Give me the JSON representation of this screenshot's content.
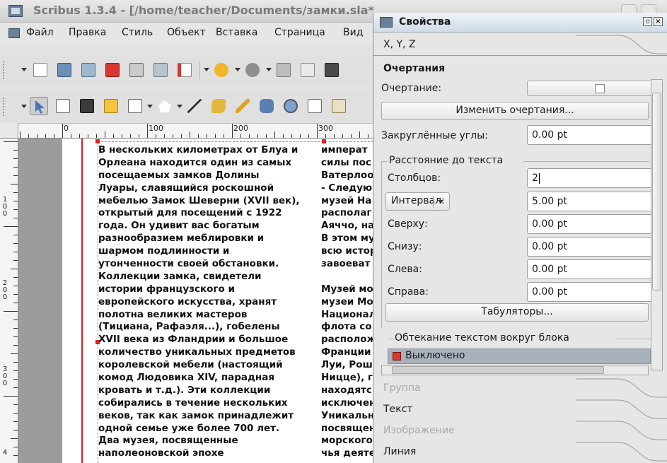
{
  "window": {
    "title": "Scribus 1.3.4 - [/home/teacher/Documents/замки.sla*"
  },
  "menubar": {
    "items": [
      "Файл",
      "Правка",
      "Стиль",
      "Объект",
      "Вставка",
      "Страница",
      "Вид"
    ]
  },
  "ruler": {
    "labels": [
      "0",
      "100",
      "200",
      "300"
    ]
  },
  "vertical_ruler": {
    "labels": [
      "100",
      "200",
      "300",
      "4"
    ]
  },
  "document": {
    "column1": [
      "В нескольких километрах от Блуа и",
      "Орлеана находится один из самых",
      "посещаемых замков Долины",
      "Луары, славящийся роскошной",
      "мебелью Замок Шеверни (XVII век),",
      "открытый для посещений с 1922",
      "года. Он удивит вас богатым",
      "разнообразием меблировки и",
      "шармом подлинности и",
      "утонченности своей обстановки.",
      "Коллекции замка, свидетели",
      "истории французского и",
      "европейского искусства, хранят",
      "полотна великих мастеров",
      "(Тициана, Рафаэля...), гобелены",
      "XVII века из Фландрии и большое",
      "количество уникальных предметов",
      "королевской мебели (настоящий",
      "комод Людовика XIV, парадная",
      "кровать и т.д.). Эти коллекции",
      "собирались в течение нескольких",
      "веков, так как замок принадлежит",
      "одной семье уже более 700 лет.",
      "Два музея, посвященные",
      "наполеоновской эпохе"
    ],
    "column2": [
      "императ",
      "силы пос",
      "Ватерлоо",
      "- Следую",
      "музей На",
      "располаг",
      "Аяччо, на",
      "В этом му",
      "всю истор",
      "завоеват",
      "",
      "Музей мо",
      "музеи Мо",
      "Национал",
      "флота со",
      "располож",
      "Франции",
      "Луи, Рош",
      "Ниццe), г",
      "находятс",
      "исключен",
      "Уникальн",
      "посвящен",
      "морского",
      "чья деяте"
    ]
  },
  "properties": {
    "title": "Свойства",
    "tabs": {
      "xyz": "X, Y, Z",
      "shape": "Очертания",
      "group": "Группа",
      "text": "Текст",
      "image": "Изображение",
      "line": "Линия"
    },
    "shape_label": "Очертание:",
    "edit_shape_button": "Изменить очертания...",
    "rounded_corners_label": "Закруглённые углы:",
    "rounded_corners_value": "0.00 pt",
    "text_distance_group": "Расстояние до текста",
    "columns_label": "Столбцов:",
    "columns_value": "2",
    "interval_label": "Интервал:",
    "interval_value": "5.00 pt",
    "top_label": "Сверху:",
    "top_value": "0.00 pt",
    "bottom_label": "Снизу:",
    "bottom_value": "0.00 pt",
    "left_label": "Слева:",
    "left_value": "0.00 pt",
    "right_label": "Справа:",
    "right_value": "0.00 pt",
    "tabulators_button": "Табуляторы...",
    "wrap_group": "Обтекание текстом вокруг блока",
    "wrap_option": "Выключено"
  }
}
